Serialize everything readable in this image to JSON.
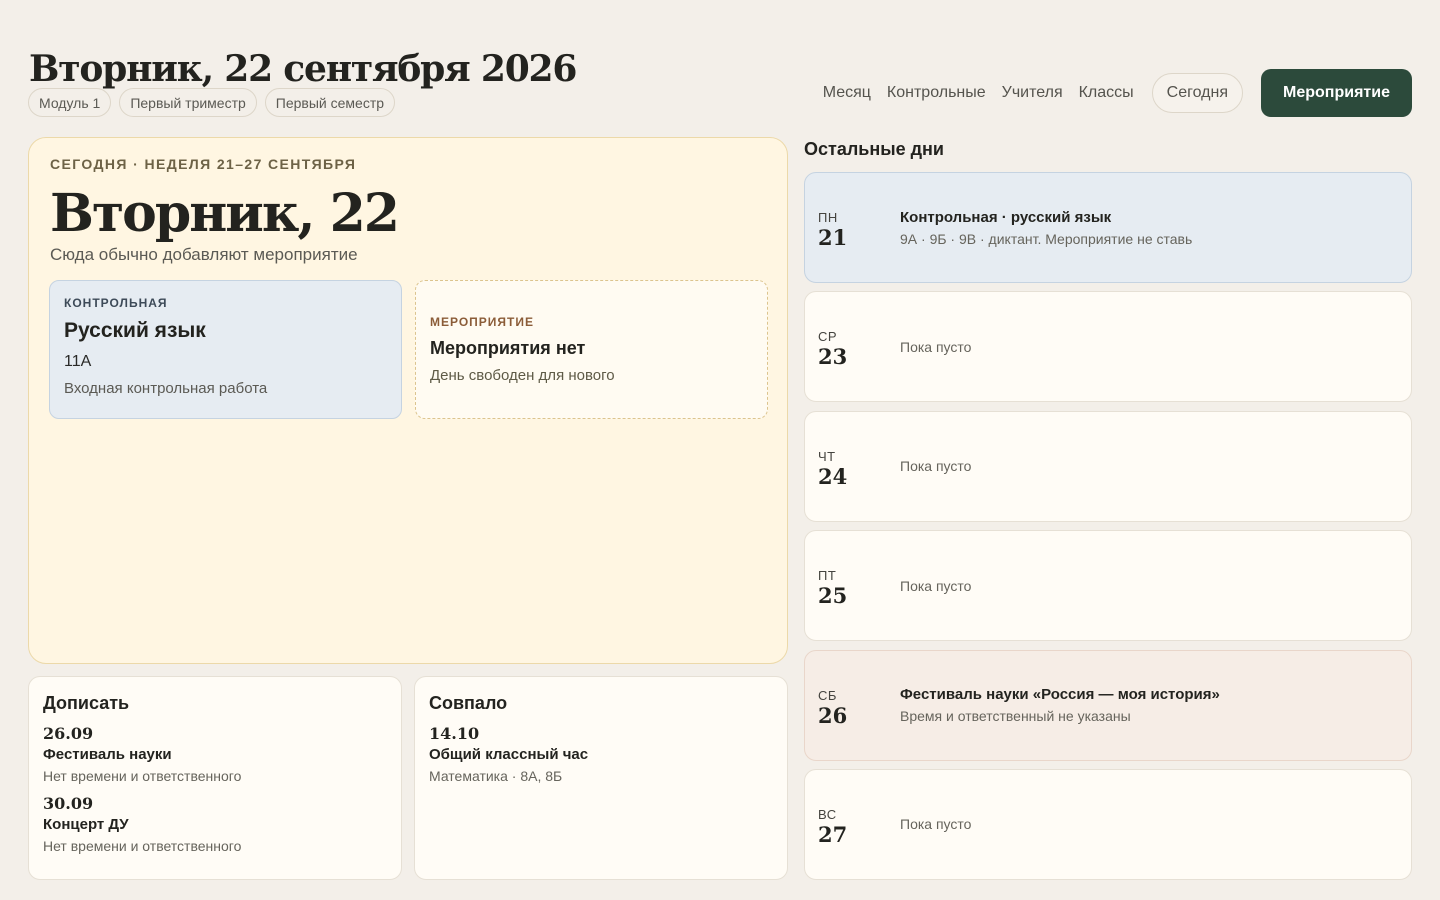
{
  "header": {
    "title": "Вторник, 22 сентября 2026",
    "chips": [
      "Модуль 1",
      "Первый триместр",
      "Первый семестр"
    ],
    "nav": [
      "Месяц",
      "Контрольные",
      "Учителя",
      "Классы"
    ],
    "today_label": "Сегодня",
    "event_label": "Мероприятие"
  },
  "today": {
    "eyebrow": "СЕГОДНЯ · НЕДЕЛЯ 21–27 СЕНТЯБРЯ",
    "date": "Вторник, 22",
    "hint": "Сюда обычно добавляют мероприятие",
    "test": {
      "kicker": "КОНТРОЛЬНАЯ",
      "subject": "Русский язык",
      "class": "11А",
      "description": "Входная контрольная работа"
    },
    "event": {
      "kicker": "МЕРОПРИЯТИЕ",
      "title": "Мероприятия нет",
      "description": "День свободен для нового"
    }
  },
  "todo": {
    "title": "Дописать",
    "items": [
      {
        "date": "26.09",
        "title": "Фестиваль науки",
        "description": "Нет времени и ответственного"
      },
      {
        "date": "30.09",
        "title": "Концерт ДУ",
        "description": "Нет времени и ответственного"
      }
    ]
  },
  "matched": {
    "title": "Совпало",
    "items": [
      {
        "date": "14.10",
        "title": "Общий классный час",
        "description": "Математика · 8А, 8Б"
      }
    ]
  },
  "rest": {
    "title": "Остальные дни",
    "days": [
      {
        "weekday": "ПН",
        "day": "21",
        "title": "Контрольная · русский язык",
        "description": "9А · 9Б · 9В · диктант. Мероприятие не ставь"
      },
      {
        "weekday": "СР",
        "day": "23",
        "empty": "Пока пусто"
      },
      {
        "weekday": "ЧТ",
        "day": "24",
        "empty": "Пока пусто"
      },
      {
        "weekday": "ПТ",
        "day": "25",
        "empty": "Пока пусто"
      },
      {
        "weekday": "СБ",
        "day": "26",
        "title": "Фестиваль науки «Россия — моя история»",
        "description": "Время и ответственный не указаны"
      },
      {
        "weekday": "ВС",
        "day": "27",
        "empty": "Пока пусто"
      }
    ]
  }
}
